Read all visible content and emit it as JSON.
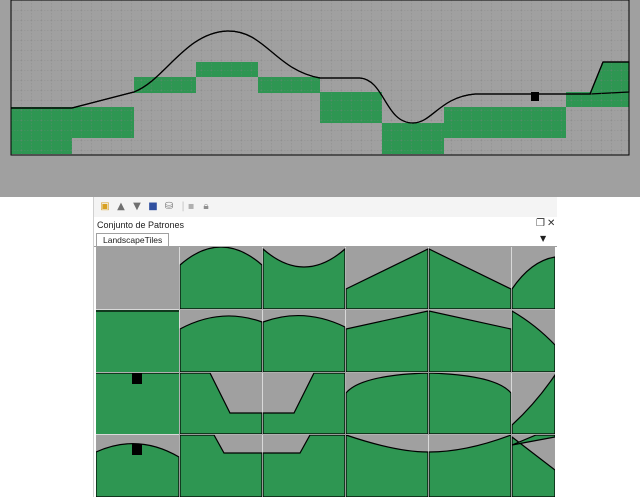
{
  "palette": {
    "title": "Conjunto de Patrones",
    "tab_label": "LandscapeTiles",
    "dropdown_icon": "triangle-down-icon",
    "controls": [
      "restore-icon",
      "close-icon"
    ],
    "toolbar_icons": [
      "new-tile-icon",
      "up-arrow-icon",
      "down-arrow-icon",
      "save-icon",
      "database-icon",
      "separator",
      "square-icon",
      "lock-icon"
    ]
  },
  "colors": {
    "green": "#2e9652",
    "gray": "#a0a0a0",
    "grid": "#7f7f7f",
    "outline": "#000000"
  }
}
